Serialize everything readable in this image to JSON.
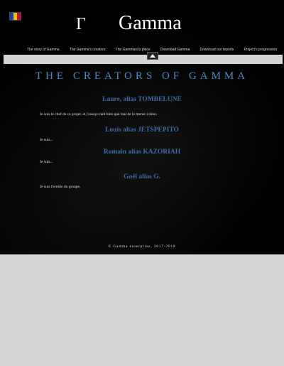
{
  "language_flag": {
    "colors": [
      "#1f3fa8",
      "#f4c400",
      "#c8102e"
    ]
  },
  "header": {
    "logo_glyph": "Γ",
    "title": "Gamma"
  },
  "nav": {
    "items": [
      {
        "label": "The story of Gamma"
      },
      {
        "label": "The Gamma's creators"
      },
      {
        "label": "The Gammara's place"
      },
      {
        "label": "Download Gamma"
      },
      {
        "label": "Download our reports"
      },
      {
        "label": "Project's progression"
      }
    ]
  },
  "main": {
    "heading": "THE CREATORS OF GAMMA",
    "members": [
      {
        "name": "Laure, alias TOMBELUNE",
        "bio": "Je suis le chef de ce projet. et j'essaye tant bien que mal de le mener à bien."
      },
      {
        "name": "Louis alias JETSPEPITO",
        "bio": "Je suis..."
      },
      {
        "name": "Romain alias KAZORIAH",
        "bio": "Je suis..."
      },
      {
        "name": "Gaël alias  G.",
        "bio": "Je suis l'ermite du groupe."
      }
    ]
  },
  "footer": {
    "text": "© Gamma enterprise, 2017-2018"
  },
  "colors": {
    "heading": "#4f88c9",
    "member_name": "#3d6aa6",
    "page_background": "#d6d6d6",
    "site_background": "#000000"
  }
}
